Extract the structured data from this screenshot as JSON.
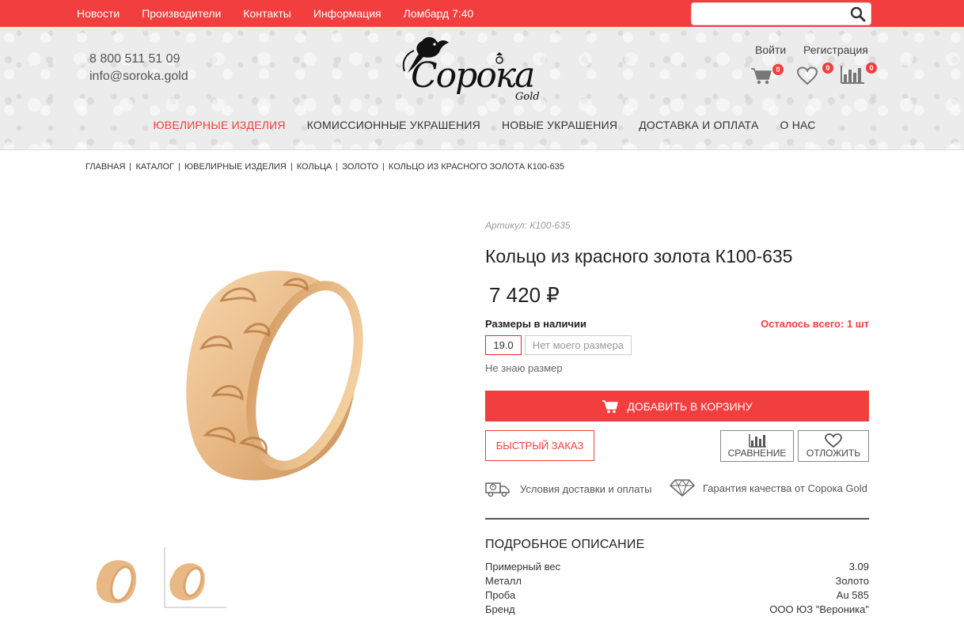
{
  "topnav": {
    "items": [
      "Новости",
      "Производители",
      "Контакты",
      "Информация",
      "Ломбард 7:40"
    ]
  },
  "search": {
    "value": "",
    "placeholder": ""
  },
  "header": {
    "phone": "8 800 511 51 09",
    "email": "info@soroka.gold",
    "logo_text": "Сорока",
    "logo_sub": "Gold",
    "login": "Войти",
    "register": "Регистрация",
    "cart_count": "0",
    "wishlist_count": "0",
    "compare_count": "0"
  },
  "mainnav": {
    "items": [
      "ЮВЕЛИРНЫЕ ИЗДЕЛИЯ",
      "КОМИССИОННЫЕ УКРАШЕНИЯ",
      "НОВЫЕ УКРАШЕНИЯ",
      "ДОСТАВКА И ОПЛАТА",
      "О НАС"
    ]
  },
  "breadcrumb": [
    "ГЛАВНАЯ",
    "КАТАЛОГ",
    "ЮВЕЛИРНЫЕ ИЗДЕЛИЯ",
    "КОЛЬЦА",
    "ЗОЛОТО",
    "КОЛЬЦО ИЗ КРАСНОГО ЗОЛОТА К100-635"
  ],
  "product": {
    "article": "Артикул: К100-635",
    "title": "Кольцо из красного золота К100-635",
    "price": "7 420 ₽",
    "sizes_label": "Размеры в наличии",
    "stock": "Осталось всего: 1 шт",
    "sizes": [
      "19.0",
      "Нет моего размера"
    ],
    "dont_know": "Не знаю размер",
    "add_to_cart": "ДОБАВИТЬ В КОРЗИНУ",
    "quick_order": "БЫСТРЫЙ ЗАКАЗ",
    "compare": "СРАВНЕНИЕ",
    "wishlist": "ОТЛОЖИТЬ",
    "delivery": "Условия доставки и оплаты",
    "quality": "Гарантия качества от Сорока Gold"
  },
  "description": {
    "title": "ПОДРОБНОЕ ОПИСАНИЕ",
    "rows": [
      {
        "label": "Примерный вес",
        "value": "3.09"
      },
      {
        "label": "Металл",
        "value": "Золото"
      },
      {
        "label": "Проба",
        "value": "Au 585"
      },
      {
        "label": "Бренд",
        "value": "ООО ЮЗ \"Вероника\""
      }
    ]
  },
  "colors": {
    "accent": "#f23e3e",
    "gold": "#e8b985"
  },
  "icons": [
    "search-icon",
    "cart-icon",
    "heart-icon",
    "chart-icon",
    "delivery-truck-icon",
    "diamond-icon"
  ]
}
